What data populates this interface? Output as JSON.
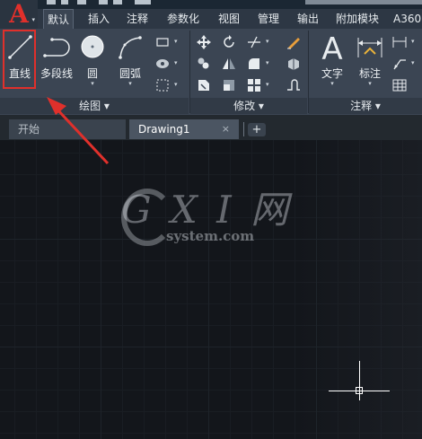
{
  "app": {
    "logo": "A"
  },
  "ribbon_tabs": [
    {
      "label": "默认",
      "active": true
    },
    {
      "label": "插入"
    },
    {
      "label": "注释"
    },
    {
      "label": "参数化"
    },
    {
      "label": "视图"
    },
    {
      "label": "管理"
    },
    {
      "label": "输出"
    },
    {
      "label": "附加模块"
    },
    {
      "label": "A360"
    }
  ],
  "draw_panel": {
    "title": "绘图",
    "line_label": "直线",
    "polyline_label": "多段线",
    "circle_label": "圆",
    "arc_label": "圆弧"
  },
  "modify_panel": {
    "title": "修改"
  },
  "annotation_panel": {
    "title": "注释",
    "text_label": "文字",
    "dimension_label": "标注"
  },
  "doc_tabs": [
    {
      "label": "开始"
    },
    {
      "label": "Drawing1",
      "active": true
    }
  ],
  "close_glyph": "×",
  "new_tab_glyph": "+",
  "panel_dropdown_glyph": "▾",
  "watermark": {
    "main": "G X I 网",
    "sub": "system.com"
  },
  "colors": {
    "highlight": "#e0302b",
    "canvas": "#13161b",
    "ribbon": "#3b4553"
  }
}
